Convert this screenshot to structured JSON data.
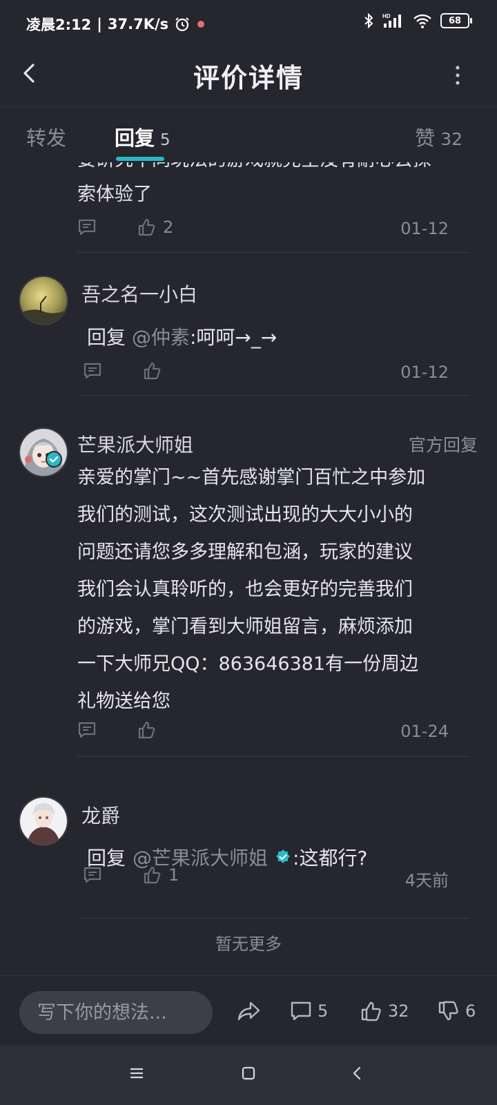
{
  "status_bar": {
    "time": "凌晨2:12",
    "net_speed": "37.7K/s",
    "battery": "68"
  },
  "header": {
    "title": "评价详情"
  },
  "tabs": {
    "forward_label": "转发",
    "reply_label": "回复",
    "reply_count": "5",
    "like_label": "赞",
    "like_count": "32"
  },
  "feed": {
    "first_partial": {
      "cut_line": "要研究不同玩法的游戏就完全没有耐心去探",
      "last_line": "索体验了",
      "likes": "2",
      "date": "01-12"
    },
    "items": [
      {
        "username": "吾之名一小白",
        "reply_prefix": "回复",
        "mention": "@仲素",
        "content": ":呵呵→_→",
        "likes": "",
        "date": "01-12"
      },
      {
        "username": "芒果派大师姐",
        "tag": "官方回复",
        "content": "亲爱的掌门~~首先感谢掌门百忙之中参加\n我们的测试，这次测试出现的大大小小的\n问题还请您多多理解和包涵，玩家的建议\n我们会认真聆听的，也会更好的完善我们\n的游戏，掌门看到大师姐留言，麻烦添加\n一下大师兄QQ：863646381有一份周边\n礼物送给您",
        "likes": "",
        "date": "01-24"
      },
      {
        "username": "龙爵",
        "reply_prefix": "回复",
        "mention": "@芒果派大师姐",
        "content": ":这都行?",
        "likes": "1",
        "date": "4天前"
      }
    ],
    "no_more": "暂无更多"
  },
  "bottom_bar": {
    "input_placeholder": "写下你的想法...",
    "comment_count": "5",
    "like_count": "32",
    "dislike_count": "6"
  },
  "colors": {
    "background": "#25262e",
    "accent": "#2bb8c8",
    "muted": "#8c8d94"
  }
}
